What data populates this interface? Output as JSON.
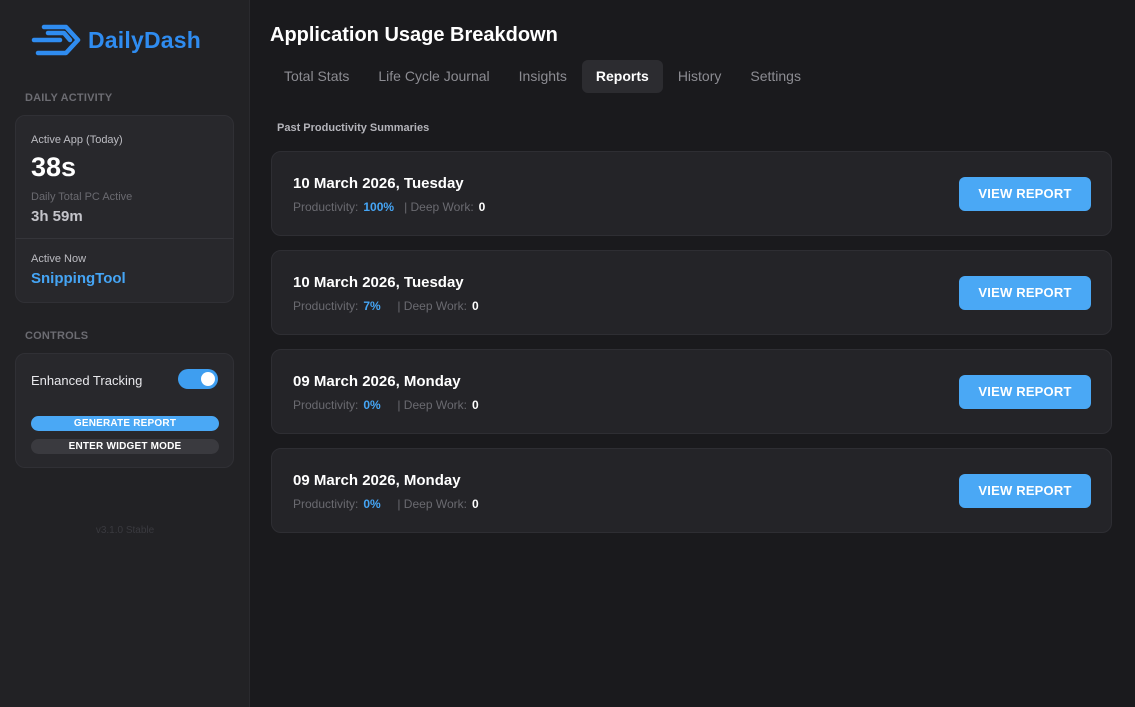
{
  "brand": {
    "name": "DailyDash",
    "accent": "#2f8cf0"
  },
  "sidebar": {
    "daily_activity_label": "DAILY ACTIVITY",
    "active_app_label": "Active App (Today)",
    "active_app_value": "38s",
    "daily_total_label": "Daily Total PC Active",
    "daily_total_value": "3h 59m",
    "active_now_label": "Active Now",
    "active_now_value": "SnippingTool",
    "controls_label": "CONTROLS",
    "enhanced_tracking_label": "Enhanced Tracking",
    "enhanced_tracking_on": true,
    "generate_report_label": "GENERATE REPORT",
    "widget_mode_label": "ENTER WIDGET MODE",
    "version": "v3.1.0 Stable"
  },
  "main": {
    "title": "Application Usage Breakdown",
    "tabs": [
      {
        "label": "Total Stats",
        "active": false
      },
      {
        "label": "Life Cycle Journal",
        "active": false
      },
      {
        "label": "Insights",
        "active": false
      },
      {
        "label": "Reports",
        "active": true
      },
      {
        "label": "History",
        "active": false
      },
      {
        "label": "Settings",
        "active": false
      }
    ],
    "subheading": "Past Productivity Summaries",
    "productivity_label": "Productivity:",
    "deep_work_label": "| Deep Work:",
    "view_report_label": "VIEW REPORT",
    "reports": [
      {
        "date": "10 March 2026, Tuesday",
        "productivity": "100%",
        "deep_work": "0"
      },
      {
        "date": "10 March 2026, Tuesday",
        "productivity": "7%",
        "deep_work": "0"
      },
      {
        "date": "09 March 2026, Monday",
        "productivity": "0%",
        "deep_work": "0"
      },
      {
        "date": "09 March 2026, Monday",
        "productivity": "0%",
        "deep_work": "0"
      }
    ]
  },
  "icons": {
    "logo": "dailydash-logo-icon"
  }
}
